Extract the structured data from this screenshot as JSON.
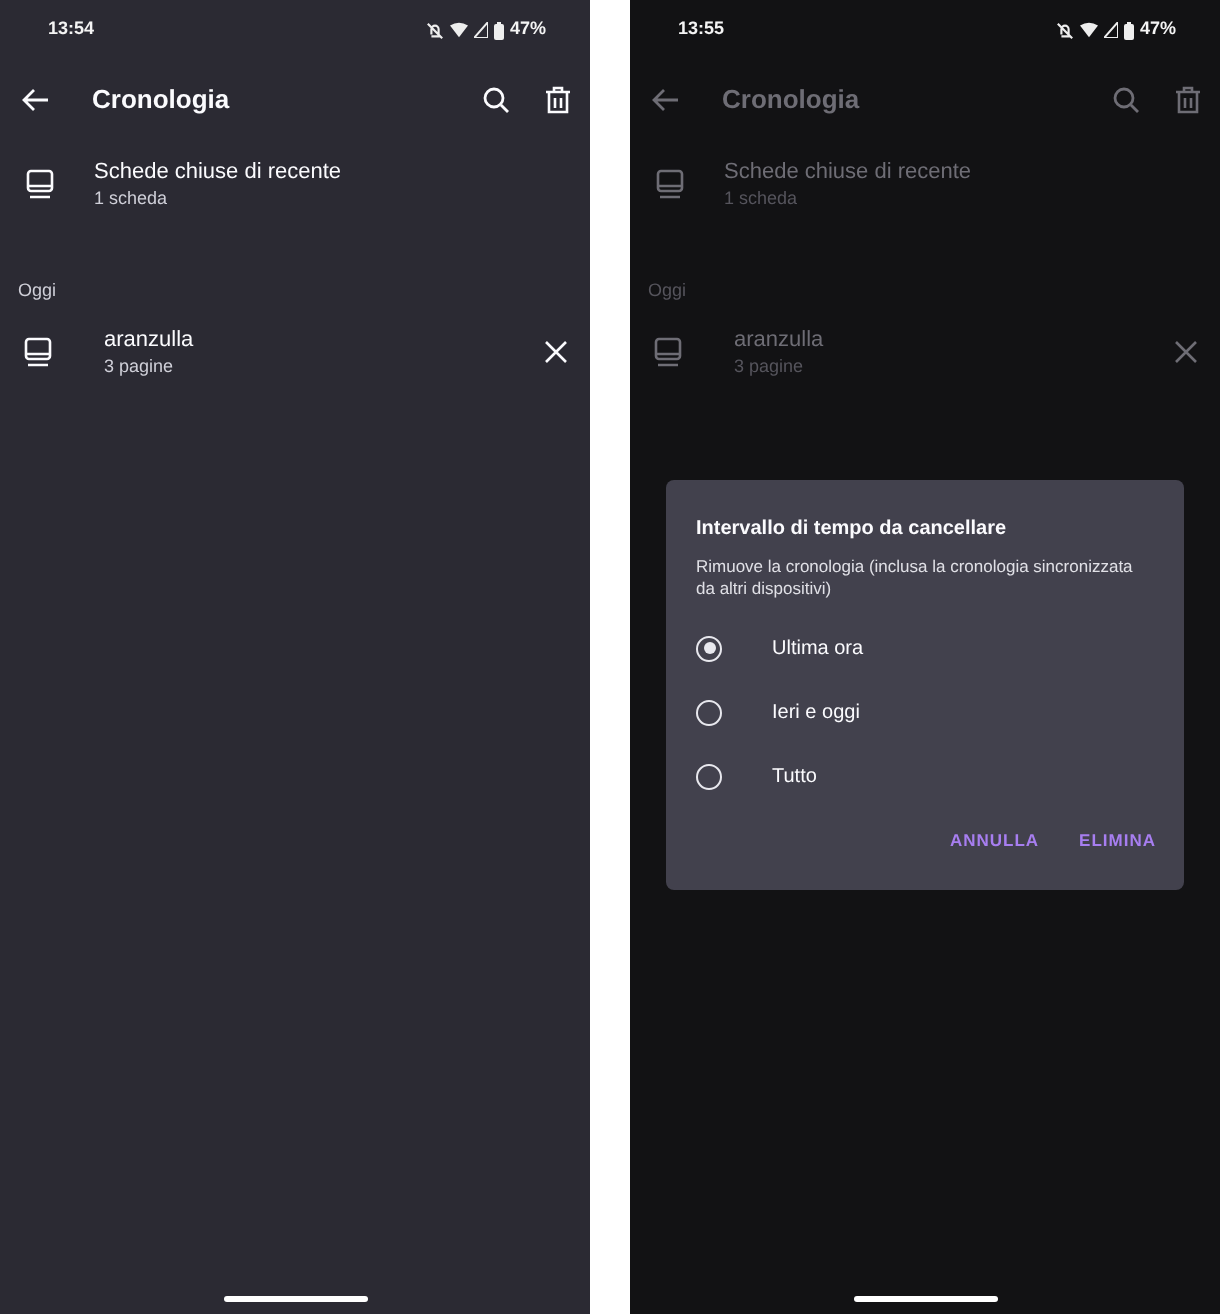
{
  "screens": [
    {
      "status_bar": {
        "time": "13:54",
        "battery": "47%"
      },
      "title": "Cronologia",
      "dimmed": false,
      "recent_tabs": {
        "title": "Schede chiuse di recente",
        "subtitle": "1 scheda"
      },
      "section": "Oggi",
      "items": [
        {
          "title": "aranzulla",
          "subtitle": "3 pagine"
        }
      ]
    },
    {
      "status_bar": {
        "time": "13:55",
        "battery": "47%"
      },
      "title": "Cronologia",
      "dimmed": true,
      "recent_tabs": {
        "title": "Schede chiuse di recente",
        "subtitle": "1 scheda"
      },
      "section": "Oggi",
      "items": [
        {
          "title": "aranzulla",
          "subtitle": "3 pagine"
        }
      ],
      "dialog": {
        "title": "Intervallo di tempo da cancellare",
        "message": "Rimuove la cronologia (inclusa la cronologia sincronizzata da altri dispositivi)",
        "options": [
          {
            "label": "Ultima ora",
            "selected": true
          },
          {
            "label": "Ieri e oggi",
            "selected": false
          },
          {
            "label": "Tutto",
            "selected": false
          }
        ],
        "buttons": [
          "ANNULLA",
          "ELIMINA"
        ]
      }
    }
  ]
}
